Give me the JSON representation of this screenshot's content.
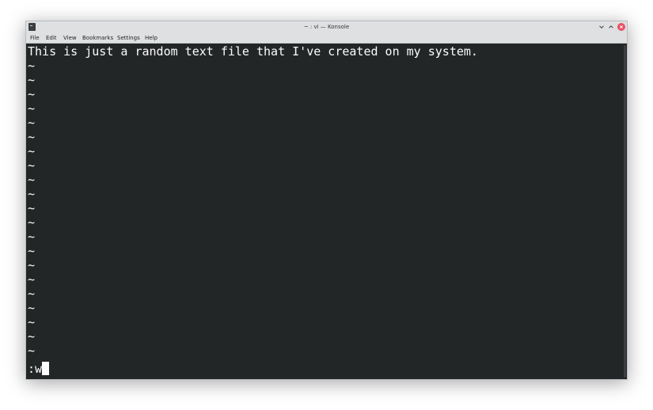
{
  "window": {
    "title": "~ : vi — Konsole"
  },
  "menubar": {
    "items": [
      "File",
      "Edit",
      "View",
      "Bookmarks",
      "Settings",
      "Help"
    ]
  },
  "terminal": {
    "first_line": "This is just a random text file that I've created on my system.",
    "tilde_lines": [
      "~",
      "~",
      "~",
      "~",
      "~",
      "~",
      "~",
      "~",
      "~",
      "~",
      "~",
      "~",
      "~",
      "~",
      "~",
      "~",
      "~",
      "~",
      "~",
      "~",
      "~"
    ],
    "command_line": ":w"
  },
  "colors": {
    "terminal_bg": "#232627",
    "terminal_fg": "#fcfcfc",
    "titlebar_bg": "#dee0e2",
    "close_button": "#e95062"
  }
}
